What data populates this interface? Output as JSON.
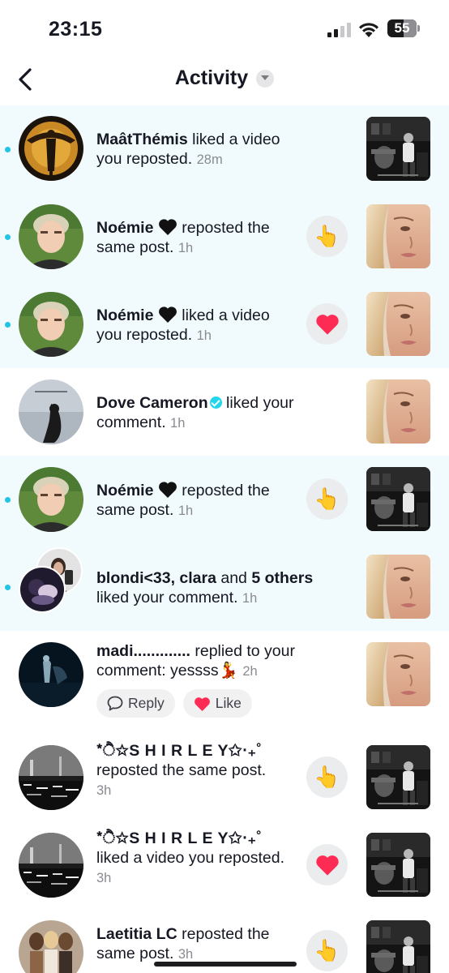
{
  "status_bar": {
    "time": "23:15",
    "battery": "55"
  },
  "header": {
    "title": "Activity"
  },
  "notifications": [
    {
      "name": "MaâtThémis",
      "message": " liked a video you reposted.",
      "time": "28m",
      "unread": true
    },
    {
      "name": "Noémie",
      "message": " reposted the same post.",
      "time": "1h",
      "unread": true,
      "action": "👆"
    },
    {
      "name": "Noémie",
      "message": " liked a video you reposted.",
      "time": "1h",
      "unread": true
    },
    {
      "name": "Dove Cameron",
      "message": " liked your comment.",
      "time": "1h",
      "unread": false
    },
    {
      "name": "Noémie",
      "message": " reposted the same post.",
      "time": "1h",
      "unread": true,
      "action": "👆"
    },
    {
      "name": "blondi<33",
      "joiner": ", ",
      "name2": "clara",
      "middle": " and ",
      "name3": "5 others",
      "message": " liked your comment.",
      "time": "1h",
      "unread": true
    },
    {
      "name": "madi.............",
      "message": " replied to your comment: yessss",
      "emoji": "💃",
      "time": "2h",
      "unread": false,
      "reply_label": "Reply",
      "like_label": "Like"
    },
    {
      "name": "*ੈ✩S H I R L E Y✩‧₊˚",
      "message": "reposted the same post.",
      "time": "3h",
      "unread": false,
      "action": "👆"
    },
    {
      "name": "*ੈ✩S H I R L E Y✩‧₊˚",
      "message": "liked a video you reposted.",
      "time": "3h",
      "unread": false
    },
    {
      "name": "Laetitia LC",
      "message": " reposted the same post.",
      "time": "3h",
      "unread": false,
      "action": "👆"
    }
  ],
  "colors": {
    "unread_bg": "#f1fbfd",
    "unread_dot": "#20c4e6",
    "like_red": "#fe2c55",
    "verified": "#20d5ec"
  },
  "icons": [
    "back-arrow-icon",
    "dropdown-caret-icon",
    "black-heart-icon",
    "verified-badge-icon",
    "pointing-hand-icon",
    "red-heart-icon",
    "comment-bubble-icon"
  ]
}
